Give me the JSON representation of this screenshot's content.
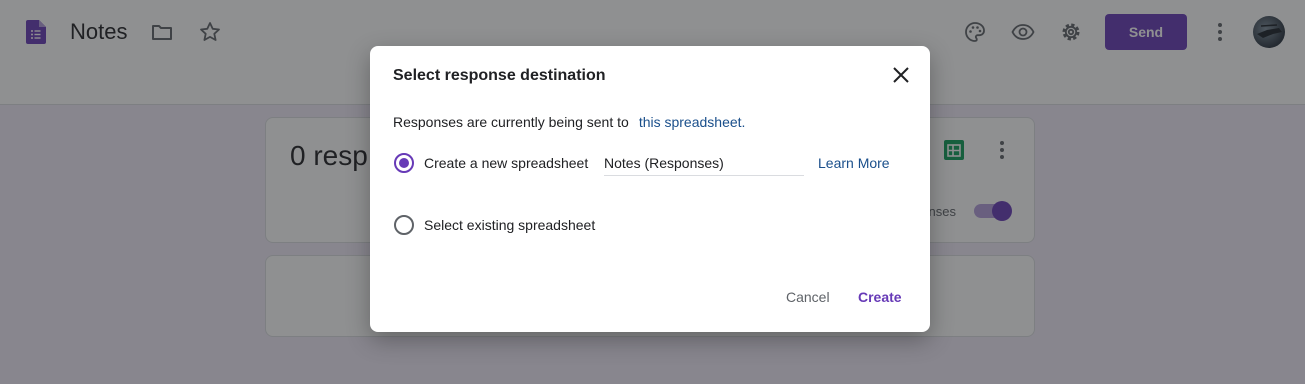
{
  "app": {
    "title": "Notes",
    "send_label": "Send"
  },
  "header_icons": [
    "forms-icon",
    "folder-icon",
    "star-icon",
    "palette-icon",
    "eye-icon",
    "gear-icon",
    "more-vert-icon"
  ],
  "responses": {
    "count_label": "0 resp",
    "accepting_label": "nses"
  },
  "dialog": {
    "title": "Select response destination",
    "destination_text": "Responses are currently being sent to",
    "destination_link": "this spreadsheet.",
    "option_new_label": "Create a new spreadsheet",
    "option_new_value": "Notes (Responses)",
    "learn_more": "Learn More",
    "option_existing_label": "Select existing spreadsheet",
    "cancel_label": "Cancel",
    "create_label": "Create"
  },
  "colors": {
    "accent": "#673ab7",
    "link": "#1a4f8b",
    "background": "#f0ebf8",
    "sheets_green": "#0f9d58"
  }
}
